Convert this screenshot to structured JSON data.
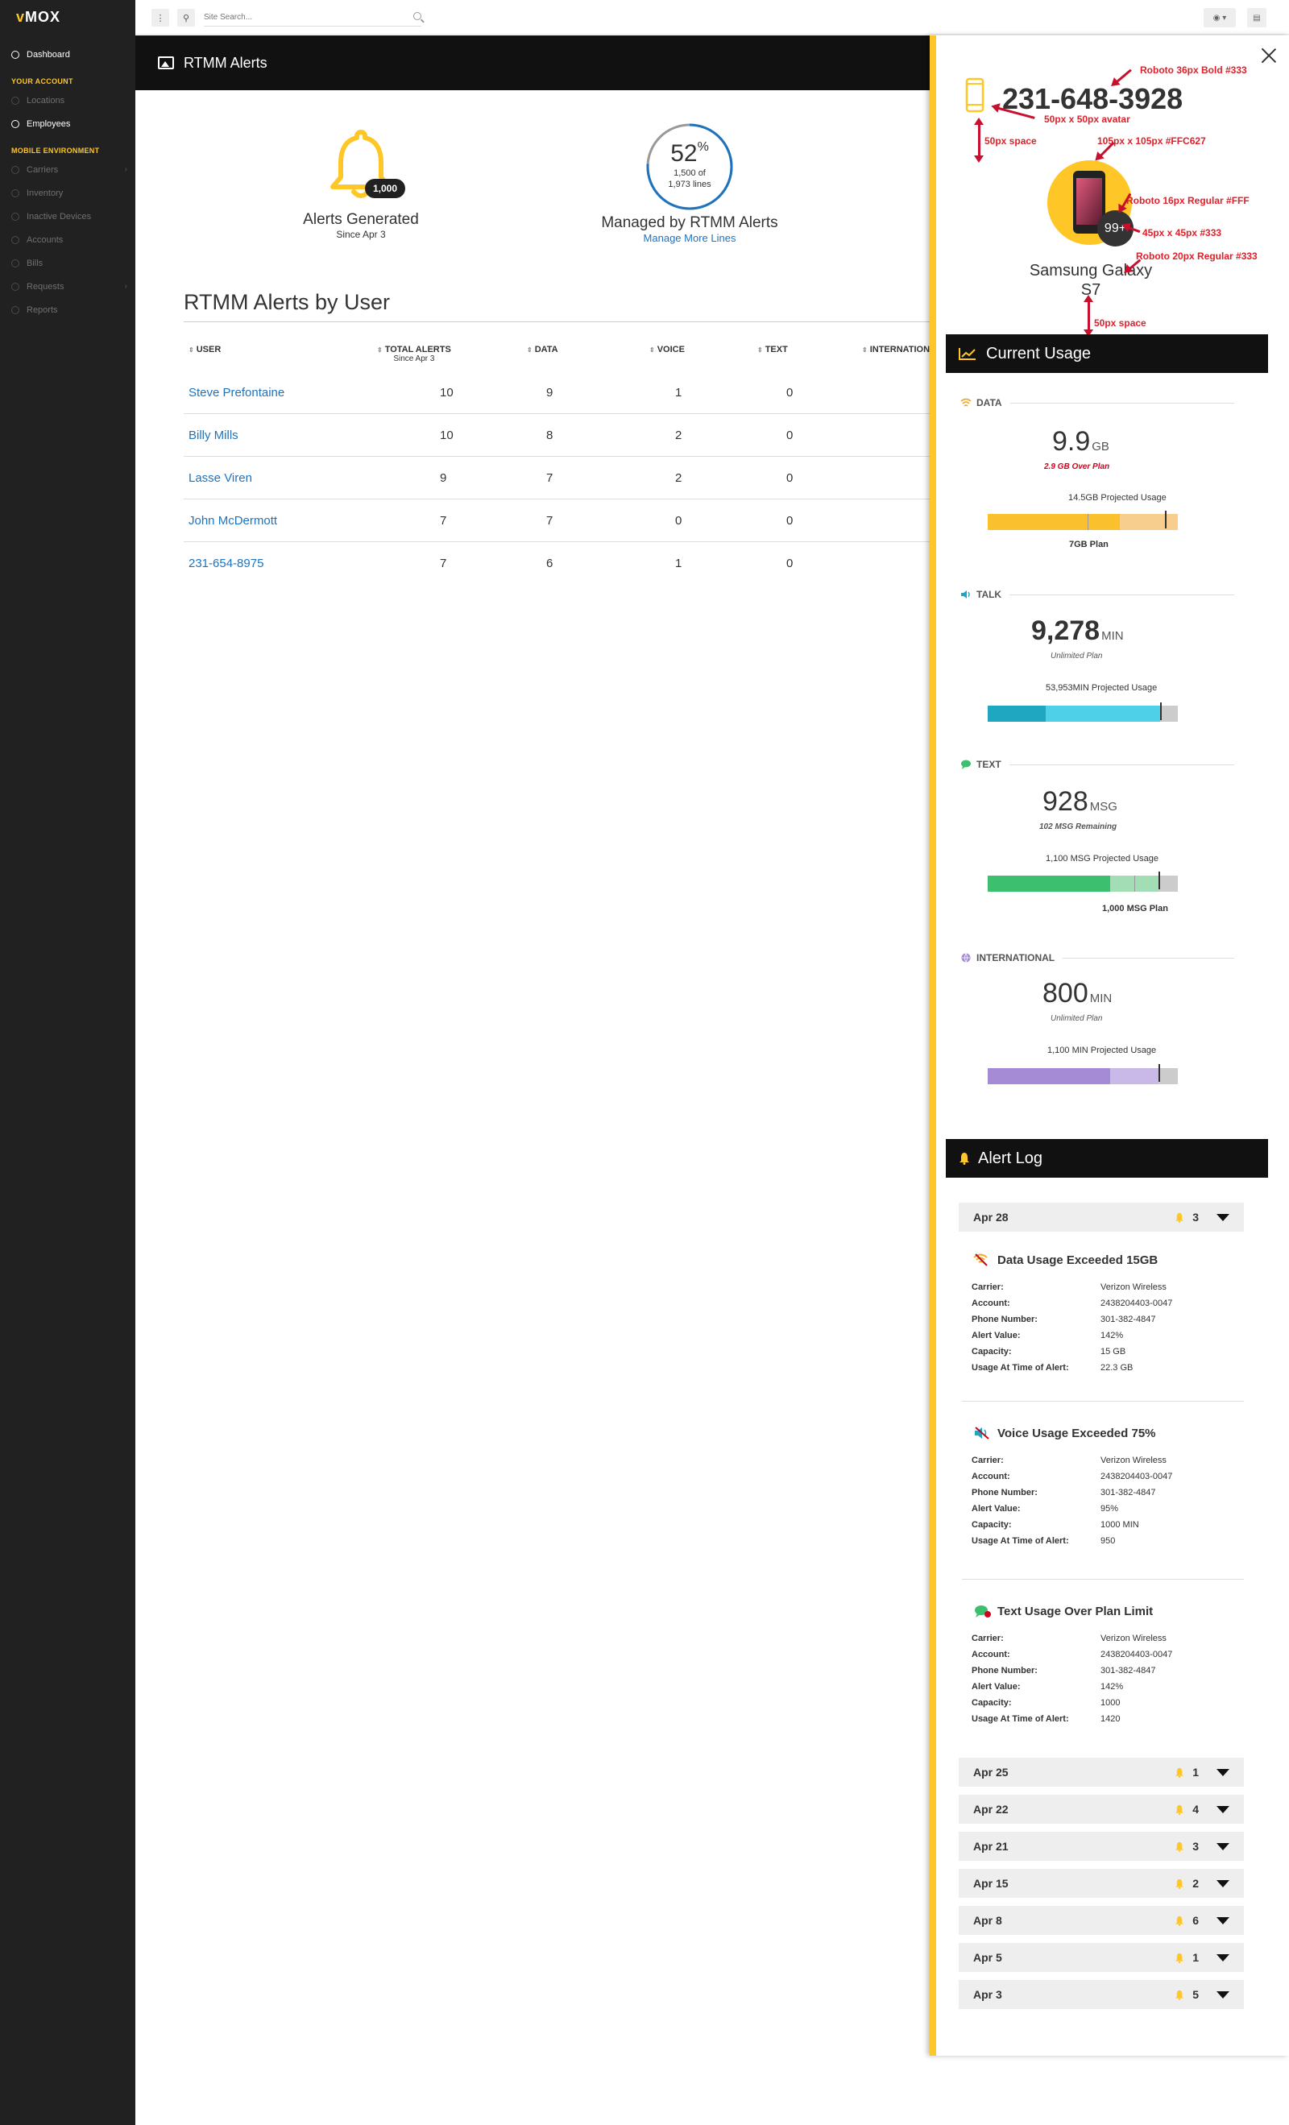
{
  "brand": {
    "logo_v": "v",
    "logo_rest": "MOX"
  },
  "sidebar": {
    "dashboard": "Dashboard",
    "section_account": "YOUR ACCOUNT",
    "account_items": [
      "Locations",
      "Employees"
    ],
    "section_mobile": "MOBILE ENVIRONMENT",
    "mobile_items": [
      "Carriers",
      "Inventory",
      "Inactive Devices",
      "Accounts",
      "Bills",
      "Requests",
      "Reports"
    ]
  },
  "topbar": {
    "search_placeholder": "Site Search..."
  },
  "page": {
    "title": "RTMM Alerts"
  },
  "kpi": {
    "alerts_badge": "1,000",
    "alerts_title": "Alerts Generated",
    "alerts_sub": "Since Apr 3",
    "managed_pct": "52",
    "managed_pct_sign": "%",
    "managed_of": "1,500 of",
    "managed_total": "1,973 lines",
    "managed_fraction": 0.76,
    "managed_title": "Managed by RTMM Alerts",
    "managed_link": "Manage More Lines"
  },
  "table": {
    "title": "RTMM Alerts by User",
    "headers": {
      "user": "USER",
      "total": "TOTAL ALERTS",
      "total_sub": "Since Apr 3",
      "data": "DATA",
      "voice": "VOICE",
      "text": "TEXT",
      "intl": "INTERNATION"
    },
    "rows": [
      {
        "user": "Steve Prefontaine",
        "total": "10",
        "data": "9",
        "voice": "1",
        "text": "0"
      },
      {
        "user": "Billy Mills",
        "total": "10",
        "data": "8",
        "voice": "2",
        "text": "0"
      },
      {
        "user": "Lasse Viren",
        "total": "9",
        "data": "7",
        "voice": "2",
        "text": "0"
      },
      {
        "user": "John McDermott",
        "total": "7",
        "data": "7",
        "voice": "0",
        "text": "0"
      },
      {
        "user": "231-654-8975",
        "total": "7",
        "data": "6",
        "voice": "1",
        "text": "0"
      }
    ]
  },
  "drawer": {
    "phone": "231-648-3928",
    "device_name_1": "Samsung Galaxy",
    "device_name_2": "S7",
    "device_badge": "99+",
    "annotations": {
      "a1": "Roboto 36px Bold #333",
      "a2": "50px x 50px avatar",
      "a3": "50px space",
      "a4": "105px x 105px #FFC627",
      "a5": "Roboto 16px Regular #FFF",
      "a6": "45px x 45px #333",
      "a7": "Roboto 20px Regular #333",
      "a8": "50px space"
    },
    "current_usage_title": "Current Usage",
    "usage": {
      "data": {
        "label": "DATA",
        "value": "9.9",
        "unit": "GB",
        "sub": "2.9 GB  Over Plan",
        "projected": "14.5GB Projected Usage",
        "plan": "7GB Plan",
        "color": "#FBC02D",
        "light": "#F7CE8E"
      },
      "talk": {
        "label": "TALK",
        "value": "9,278",
        "unit": "MIN",
        "sub": "Unlimited Plan",
        "projected": "53,953MIN Projected Usage",
        "color": "#1FA7C1",
        "light": "#4DD0E8"
      },
      "text": {
        "label": "TEXT",
        "value": "928",
        "unit": "MSG",
        "sub": "102 MSG Remaining",
        "projected": "1,100 MSG Projected Usage",
        "plan": "1,000 MSG Plan",
        "color": "#3CBF6E",
        "light": "#A2DDB5"
      },
      "intl": {
        "label": "INTERNATIONAL",
        "value": "800",
        "unit": "MIN",
        "sub": "Unlimited Plan",
        "projected": "1,100 MIN Projected Usage",
        "color": "#A58BD6",
        "light": "#C9B9E8"
      }
    },
    "alert_log_title": "Alert Log",
    "open_day": {
      "date": "Apr 28",
      "count": "3"
    },
    "alerts": [
      {
        "title": "Data Usage Exceeded 15GB",
        "icon": "wifi-alert-icon",
        "carrier": "Verizon Wireless",
        "account": "2438204403-0047",
        "phone": "301-382-4847",
        "value": "142%",
        "capacity": "15 GB",
        "usage": "22.3 GB"
      },
      {
        "title": "Voice Usage Exceeded 75%",
        "icon": "speaker-alert-icon",
        "carrier": "Verizon Wireless",
        "account": "2438204403-0047",
        "phone": "301-382-4847",
        "value": "95%",
        "capacity": "1000 MIN",
        "usage": "950"
      },
      {
        "title": "Text Usage Over Plan Limit",
        "icon": "chat-alert-icon",
        "carrier": "Verizon Wireless",
        "account": "2438204403-0047",
        "phone": "301-382-4847",
        "value": "142%",
        "capacity": "1000",
        "usage": "1420"
      }
    ],
    "field_labels": {
      "carrier": "Carrier:",
      "account": "Account:",
      "phone": "Phone Number:",
      "value": "Alert Value:",
      "capacity": "Capacity:",
      "usage": "Usage At Time of Alert:"
    },
    "days": [
      {
        "date": "Apr 25",
        "count": "1"
      },
      {
        "date": "Apr 22",
        "count": "4"
      },
      {
        "date": "Apr 21",
        "count": "3"
      },
      {
        "date": "Apr 15",
        "count": "2"
      },
      {
        "date": "Apr 8",
        "count": "6"
      },
      {
        "date": "Apr 5",
        "count": "1"
      },
      {
        "date": "Apr 3",
        "count": "5"
      }
    ]
  },
  "colors": {
    "accent": "#FFC627",
    "link": "#1E73BE",
    "sidebar": "#212121",
    "annotation": "#E0202A"
  }
}
